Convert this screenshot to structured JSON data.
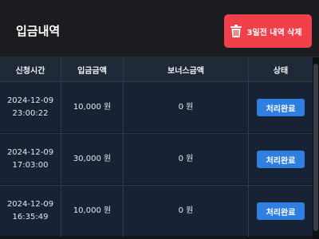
{
  "header": {
    "title": "입금내역",
    "delete_button_label": "3일전 내역 삭제",
    "delete_icon": "trash-icon"
  },
  "table": {
    "columns": [
      "신청시간",
      "입금금액",
      "보너스금액",
      "상태"
    ],
    "rows": [
      {
        "date": "2024-12-09",
        "time": "23:00:22",
        "amount": "10,000 원",
        "bonus": "0 원",
        "status": "처리완료"
      },
      {
        "date": "2024-12-09",
        "time": "17:03:00",
        "amount": "30,000 원",
        "bonus": "0 원",
        "status": "처리완료"
      },
      {
        "date": "2024-12-09",
        "time": "16:35:49",
        "amount": "10,000 원",
        "bonus": "0 원",
        "status": "처리완료"
      }
    ]
  },
  "colors": {
    "delete_button": "#f2404a",
    "status_button": "#2f7fe0",
    "table_header": "#1f2a38",
    "table_row": "#172334"
  }
}
